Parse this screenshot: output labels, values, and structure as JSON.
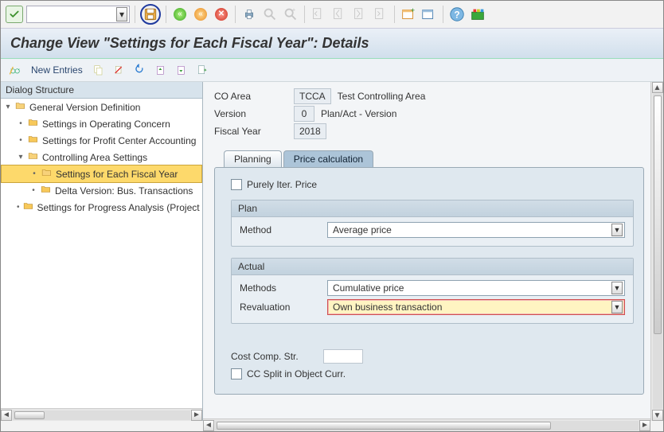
{
  "toolbar": {},
  "title": "Change View \"Settings for Each Fiscal Year\": Details",
  "btnrow": {
    "new_entries": "New Entries"
  },
  "left": {
    "header": "Dialog Structure",
    "tree": {
      "root": "General Version Definition",
      "n1": "Settings in Operating Concern",
      "n2": "Settings for Profit Center Accounting",
      "n3": "Controlling Area Settings",
      "n3a": "Settings for Each Fiscal Year",
      "n3b": "Delta Version: Bus. Transactions",
      "n4": "Settings for Progress Analysis (Project System)"
    }
  },
  "header_fields": {
    "co_area_label": "CO Area",
    "co_area_code": "TCCA",
    "co_area_text": "Test Controlling Area",
    "version_label": "Version",
    "version_code": "0",
    "version_text": "Plan/Act - Version",
    "fy_label": "Fiscal Year",
    "fy_code": "2018"
  },
  "tabs": {
    "planning": "Planning",
    "price": "Price calculation"
  },
  "form": {
    "purely_iter": "Purely Iter. Price",
    "plan_head": "Plan",
    "plan_method_label": "Method",
    "plan_method_value": "Average price",
    "actual_head": "Actual",
    "actual_methods_label": "Methods",
    "actual_methods_value": "Cumulative price",
    "reval_label": "Revaluation",
    "reval_value": "Own business transaction",
    "ccs_label": "Cost Comp. Str.",
    "cc_split_label": "CC Split in Object Curr."
  }
}
